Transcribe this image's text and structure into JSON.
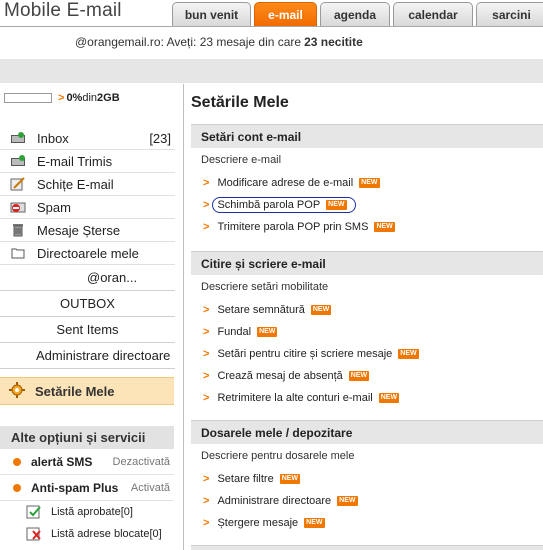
{
  "header": {
    "app_title": "Mobile E-mail",
    "tabs": [
      {
        "label": "bun venit",
        "active": false
      },
      {
        "label": "e-mail",
        "active": true
      },
      {
        "label": "agenda",
        "active": false
      },
      {
        "label": "calendar",
        "active": false
      },
      {
        "label": "sarcini",
        "active": false
      }
    ]
  },
  "status": {
    "account": "@orangemail.ro",
    "message": ": Aveți: 23 mesaje din care",
    "unread": "23 necitite"
  },
  "quota": {
    "arrow": ">",
    "percent": "0%",
    "text": " din ",
    "total": "2GB",
    "usage_fraction": 0.0
  },
  "folders": [
    {
      "label": "Inbox",
      "count": "[23]",
      "icon": "inbox-icon"
    },
    {
      "label": "E-mail Trimis",
      "count": "",
      "icon": "sent-icon"
    },
    {
      "label": "Schițe E-mail",
      "count": "",
      "icon": "drafts-icon"
    },
    {
      "label": "Spam",
      "count": "",
      "icon": "spam-icon"
    },
    {
      "label": "Mesaje Șterse",
      "count": "",
      "icon": "trash-icon"
    },
    {
      "label": "Directoarele mele",
      "count": "",
      "icon": "folder-icon"
    }
  ],
  "subfolders": [
    "@oran...",
    "OUTBOX",
    "Sent Items",
    "Administrare directoare"
  ],
  "settings_nav": {
    "label": "Setările Mele",
    "icon": "settings-gear-icon"
  },
  "services": {
    "title": "Alte opțiuni și servicii",
    "items": [
      {
        "name": "alertă SMS",
        "state": "Dezactivată"
      },
      {
        "name": "Anti-spam Plus",
        "state": "Activată"
      }
    ],
    "lists": [
      {
        "label": "Listă aprobate",
        "count": "[0]",
        "icon": "approved-list-icon"
      },
      {
        "label": "Listă adrese blocate",
        "count": "[0]",
        "icon": "blocked-list-icon"
      }
    ]
  },
  "main": {
    "title": "Setările Mele",
    "new_badge": "NEW",
    "chev": ">",
    "sections": [
      {
        "heading": "Setări cont e-mail",
        "description": "Descriere e-mail",
        "links": [
          "Modificare adrese de e-mail",
          "Schimbă parola POP",
          "Trimitere parola POP prin SMS"
        ]
      },
      {
        "heading": "Citire și scriere e-mail",
        "description": "Descriere setări mobilitate",
        "links": [
          "Setare semnătură",
          "Fundal",
          "Setări pentru citire și scriere mesaje",
          "Crează mesaj de absență",
          "Retrimitere la alte conturi e-mail"
        ]
      },
      {
        "heading": "Dosarele mele / depozitare",
        "description": "Descriere pentru dosarele mele",
        "links": [
          "Setare filtre",
          "Administrare directoare",
          "Ștergere mesaje"
        ]
      }
    ]
  },
  "colors": {
    "accent": "#f07800",
    "highlight_bg": "#fde3b8",
    "circle": "#1d2fa8"
  }
}
